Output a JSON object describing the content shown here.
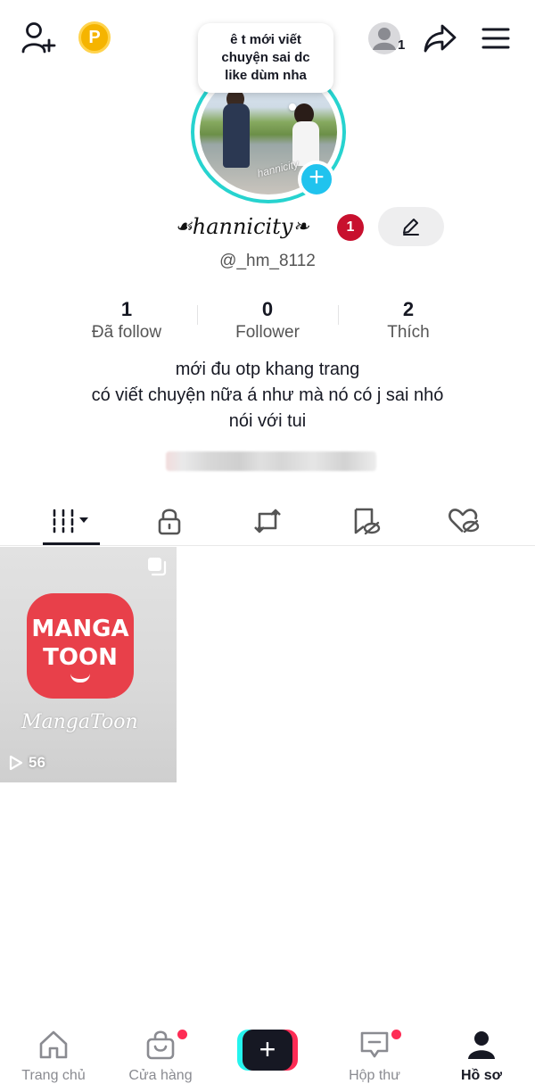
{
  "header": {
    "add_friend_icon": "person-plus-icon",
    "coin_badge": "P",
    "account_switch_count": "1",
    "share_icon": "share-arrow-icon",
    "menu_icon": "hamburger-menu-icon"
  },
  "note_bubble": {
    "line1": "ê t mới viết",
    "line2": "chuyện sai dc",
    "line3": "like dùm nha"
  },
  "avatar": {
    "watermark": "hannicity",
    "add_button": "+"
  },
  "profile": {
    "flourish_left": "☙",
    "display_name": "hannicity",
    "flourish_right": "❧",
    "notification_badge": "1",
    "username": "@_hm_8112"
  },
  "stats": [
    {
      "value": "1",
      "label": "Đã follow"
    },
    {
      "value": "0",
      "label": "Follower"
    },
    {
      "value": "2",
      "label": "Thích"
    }
  ],
  "bio": {
    "line1": "mới đu otp khang trang",
    "line2": "có viết chuyện nữa á như mà nó có j sai nhó",
    "line3": "nói với tui"
  },
  "tabs": [
    {
      "icon": "video-grid-icon",
      "active": true
    },
    {
      "icon": "lock-icon",
      "active": false
    },
    {
      "icon": "repost-icon",
      "active": false
    },
    {
      "icon": "bookmark-hidden-icon",
      "active": false
    },
    {
      "icon": "liked-hidden-icon",
      "active": false
    }
  ],
  "videos": [
    {
      "logo_line1": "MANGA",
      "logo_line2": "TOON",
      "caption": "MangaToon",
      "views": "56"
    }
  ],
  "colors": {
    "accent": "#fe2c55",
    "ring": "#27d3cf",
    "plus": "#20c3ee",
    "coin": "#f5b400",
    "badge": "#c8102e"
  },
  "bottom_nav": {
    "home": "Trang chủ",
    "shop": "Cửa hàng",
    "create": "+",
    "inbox": "Hộp thư",
    "profile": "Hồ sơ"
  }
}
